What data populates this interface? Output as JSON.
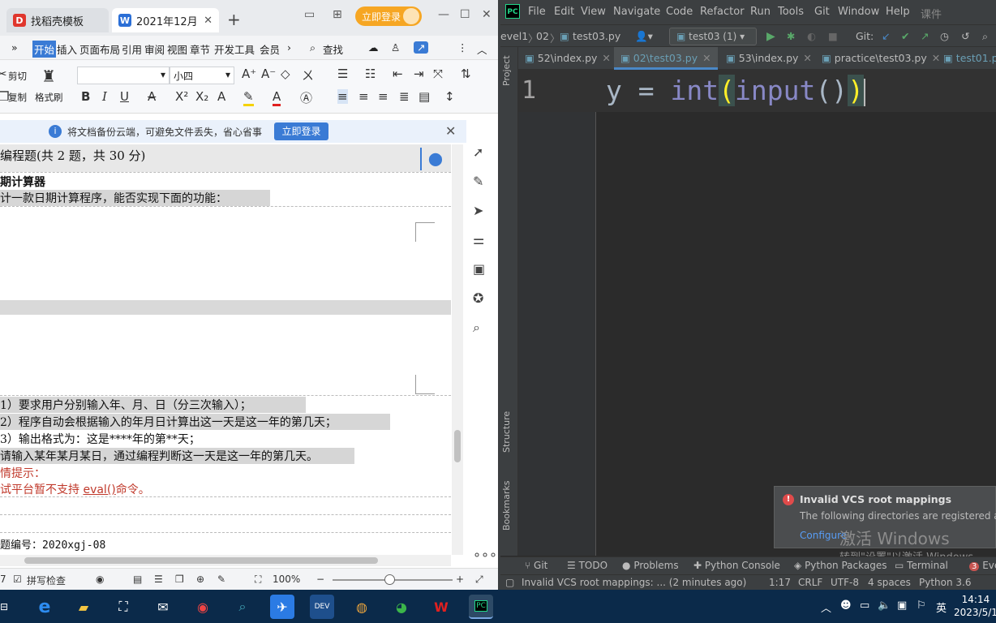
{
  "wps": {
    "tabs": [
      {
        "label": "找稻壳模板"
      },
      {
        "label": "2021年12月"
      }
    ],
    "login_label": "立即登录",
    "menu": [
      "开始",
      "插入",
      "页面布局",
      "引用",
      "审阅",
      "视图",
      "章节",
      "开发工具",
      "会员"
    ],
    "search_label": "查找",
    "ribbon": {
      "cut": "剪切",
      "copy": "复制",
      "format_painter": "格式刷",
      "font_name": "",
      "font_size": "小四"
    },
    "notice": {
      "text": "将文档备份云端，可避免文件丢失，省心省事",
      "button": "立即登录"
    },
    "doc": {
      "section": "编程题(共 2 题，共 30 分)",
      "title": "期计算器",
      "intro": "计一款日期计算程序，能否实现下面的功能：",
      "items": [
        "1）要求用户分别输入年、月、日（分三次输入）；",
        "2）程序自动会根据输入的年月日计算出这一天是这一年的第几天；",
        "3）输出格式为：这是****年的第**天；",
        "请输入某年某月某日，通过编程判断这一天是这一年的第几天。"
      ],
      "hint_title": "情提示：",
      "hint_body_prefix": "试平台暂不支持",
      "hint_body_code": "eval()",
      "hint_body_suffix": "命令。",
      "question_id": "题编号：2020xgj-08"
    },
    "status": {
      "spell": "拼写检查",
      "zoom": "100%"
    }
  },
  "pycharm": {
    "menu": [
      "File",
      "Edit",
      "View",
      "Navigate",
      "Code",
      "Refactor",
      "Run",
      "Tools",
      "Git",
      "Window",
      "Help",
      "课件"
    ],
    "breadcrumb": [
      "evel1",
      "02",
      "test03.py"
    ],
    "run_config": "test03 (1)",
    "git_label": "Git:",
    "tabs": [
      {
        "label": "52\\index.py",
        "active": false
      },
      {
        "label": "02\\test03.py",
        "active": true
      },
      {
        "label": "53\\index.py",
        "active": false
      },
      {
        "label": "practice\\test03.py",
        "active": false
      },
      {
        "label": "test01.py",
        "active": false
      }
    ],
    "side_labels": {
      "project": "Project",
      "structure": "Structure",
      "bookmarks": "Bookmarks"
    },
    "line_number": "1",
    "code": {
      "var": "y",
      "op": " = ",
      "fn1": "int",
      "fn2": "input"
    },
    "notification": {
      "title": "Invalid VCS root mappings",
      "body": "The following directories are registered a",
      "link": "Configure"
    },
    "watermark": {
      "line1": "激活 Windows",
      "line2": "转到\"设置\"以激活 Windows。"
    },
    "toolwindows": [
      "Git",
      "TODO",
      "Problems",
      "Python Console",
      "Python Packages",
      "Terminal",
      "Eve"
    ],
    "event_count": "3",
    "statusbar": {
      "message": "Invalid VCS root mappings: ... (2 minutes ago)",
      "position": "1:17",
      "line_sep": "CRLF",
      "encoding": "UTF-8",
      "indent": "4 spaces",
      "interpreter": "Python 3.6"
    }
  },
  "taskbar": {
    "ime": "英",
    "time": "14:14",
    "date": "2023/5/1"
  }
}
